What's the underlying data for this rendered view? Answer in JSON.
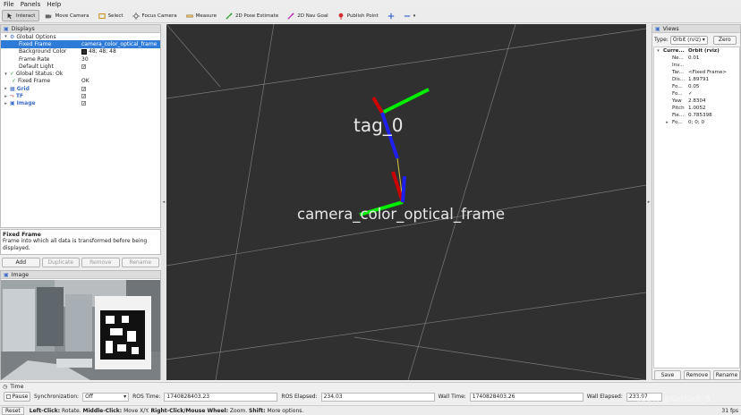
{
  "menu": [
    "File",
    "Panels",
    "Help"
  ],
  "toolbar": [
    {
      "label": "Interact",
      "icon": "interact-icon",
      "active": true
    },
    {
      "label": "Move Camera",
      "icon": "move-camera-icon"
    },
    {
      "label": "Select",
      "icon": "select-icon"
    },
    {
      "label": "Focus Camera",
      "icon": "focus-camera-icon"
    },
    {
      "label": "Measure",
      "icon": "measure-icon"
    },
    {
      "label": "2D Pose Estimate",
      "icon": "pose-estimate-icon"
    },
    {
      "label": "2D Nav Goal",
      "icon": "nav-goal-icon"
    },
    {
      "label": "Publish Point",
      "icon": "publish-point-icon"
    }
  ],
  "displays": {
    "title": "Displays",
    "global_options": "Global Options",
    "fixed_frame_label": "Fixed Frame",
    "fixed_frame_value": "camera_color_optical_frame",
    "background_color_label": "Background Color",
    "background_color_value": "48; 48; 48",
    "frame_rate_label": "Frame Rate",
    "frame_rate_value": "30",
    "default_light_label": "Default Light",
    "global_status": "Global Status: Ok",
    "status_fixed_frame_label": "Fixed Frame",
    "status_fixed_frame_value": "OK",
    "grid": "Grid",
    "tf": "TF",
    "image": "Image"
  },
  "description": {
    "title": "Fixed Frame",
    "text": "Frame into which all data is transformed before being displayed."
  },
  "display_buttons": {
    "add": "Add",
    "duplicate": "Duplicate",
    "remove": "Remove",
    "rename": "Rename"
  },
  "image_panel": {
    "title": "Image"
  },
  "viewport": {
    "tag_label": "tag_0",
    "camera_label": "camera_color_optical_frame",
    "background": "#303030"
  },
  "views": {
    "title": "Views",
    "type_label": "Type:",
    "type_value": "Orbit (rviz)",
    "zero": "Zero",
    "current_label": "Curre...",
    "current_value": "Orbit (rviz)",
    "rows": [
      {
        "name": "Ne...",
        "value": "0.01"
      },
      {
        "name": "Inv...",
        "value": ""
      },
      {
        "name": "Tar...",
        "value": "<Fixed Frame>"
      },
      {
        "name": "Dis...",
        "value": "1.89791"
      },
      {
        "name": "Fo...",
        "value": "0.05"
      },
      {
        "name": "Fo...",
        "value": "✓"
      },
      {
        "name": "Yaw",
        "value": "2.8304"
      },
      {
        "name": "Pitch",
        "value": "1.0052"
      },
      {
        "name": "Fie...",
        "value": "0.785398"
      }
    ],
    "focal_label": "Fo...",
    "focal_value": "0; 0; 0",
    "save": "Save",
    "remove": "Remove",
    "rename": "Rename"
  },
  "time": {
    "title": "Time",
    "pause": "Pause",
    "sync_label": "Synchronization:",
    "sync_value": "Off",
    "ros_time_label": "ROS Time:",
    "ros_time_value": "1740828403.23",
    "ros_elapsed_label": "ROS Elapsed:",
    "ros_elapsed_value": "234.03",
    "wall_time_label": "Wall Time:",
    "wall_time_value": "1740828403.26",
    "wall_elapsed_label": "Wall Elapsed:",
    "wall_elapsed_value": "233.97"
  },
  "status": {
    "reset": "Reset",
    "left_click": "Left-Click:",
    "left_action": "Rotate.",
    "middle_click": "Middle-Click:",
    "middle_action": "Move X/Y.",
    "right_click": "Right-Click/Mouse Wheel:",
    "right_action": "Zoom.",
    "shift": "Shift:",
    "shift_action": "More options.",
    "fps": "31 fps"
  },
  "watermark": "CSDN @Kettle9_3"
}
